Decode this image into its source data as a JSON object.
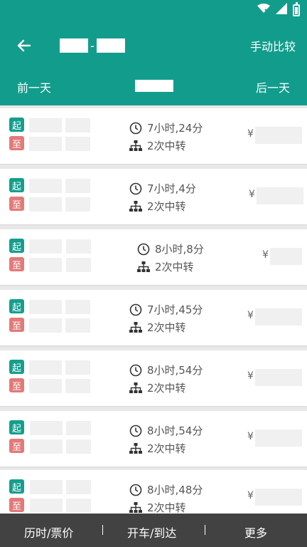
{
  "header": {
    "compare_label": "手动比较",
    "route_separator": "-",
    "prev_day_label": "前一天",
    "next_day_label": "后一天"
  },
  "results": [
    {
      "dep_badge": "起",
      "arr_badge": "至",
      "duration": "7小时,24分",
      "transfers": "2次中转",
      "currency": "¥"
    },
    {
      "dep_badge": "起",
      "arr_badge": "至",
      "duration": "7小时,4分",
      "transfers": "2次中转",
      "currency": "¥"
    },
    {
      "dep_badge": "起",
      "arr_badge": "至",
      "duration": "8小时,8分",
      "transfers": "2次中转",
      "currency": "¥"
    },
    {
      "dep_badge": "起",
      "arr_badge": "至",
      "duration": "7小时,45分",
      "transfers": "2次中转",
      "currency": "¥"
    },
    {
      "dep_badge": "起",
      "arr_badge": "至",
      "duration": "8小时,54分",
      "transfers": "2次中转",
      "currency": "¥"
    },
    {
      "dep_badge": "起",
      "arr_badge": "至",
      "duration": "8小时,54分",
      "transfers": "2次中转",
      "currency": "¥"
    },
    {
      "dep_badge": "起",
      "arr_badge": "至",
      "duration": "8小时,48分",
      "transfers": "2次中转",
      "currency": "¥"
    }
  ],
  "bottom_bar": {
    "duration_price_label": "历时/票价",
    "depart_arrive_label": "开车/到达",
    "more_label": "更多"
  },
  "colors": {
    "primary": "#129c8c",
    "depart_badge": "#159e8d",
    "arrive_badge": "#e27a78",
    "bottom_bar": "#424242"
  },
  "icons": {
    "back": "arrow-left-icon",
    "duration": "clock-icon",
    "transfer": "hierarchy-icon",
    "wifi": "wifi-off-icon",
    "signal": "signal-icon",
    "battery": "battery-icon"
  }
}
